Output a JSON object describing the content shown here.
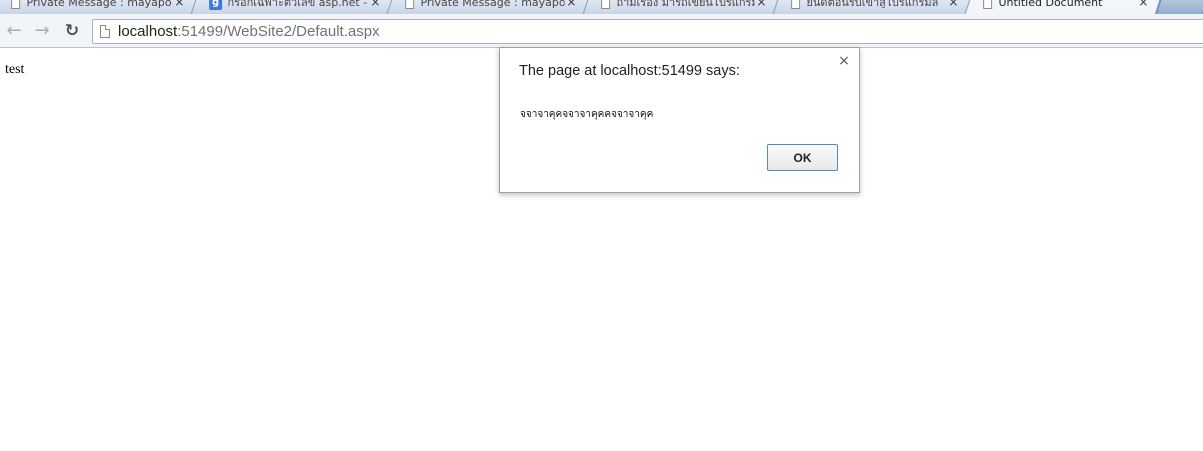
{
  "browser": {
    "tabs": [
      {
        "title": "Private Message : mayapo",
        "icon": "page-icon",
        "active": false
      },
      {
        "title": "กรอกเฉพาะตัวเลข asp.net -",
        "icon": "google-icon",
        "active": false
      },
      {
        "title": "Private Message : mayapo",
        "icon": "page-icon",
        "active": false
      },
      {
        "title": "ถามเรื่อง มารถเขียนโปรแกรม",
        "icon": "page-icon",
        "active": false
      },
      {
        "title": "ยินดีต้อนรับเข้าสู่โปรแกรมล",
        "icon": "page-icon",
        "active": false
      },
      {
        "title": "Untitled Document",
        "icon": "page-icon",
        "active": true
      }
    ],
    "tab_close_glyph": "×",
    "google_glyph": "g",
    "address": {
      "host": "localhost",
      "rest": ":51499/WebSite2/Default.aspx"
    }
  },
  "page": {
    "body_text": "test"
  },
  "dialog": {
    "title": "The page at localhost:51499 says:",
    "message": "จจาจาคุคจจาจาคุคคจจาจาคุค",
    "ok_label": "OK",
    "close_glyph": "×"
  },
  "colors": {
    "tabstrip_bg": "#6b8fbd",
    "ok_border": "#5a86c5"
  }
}
